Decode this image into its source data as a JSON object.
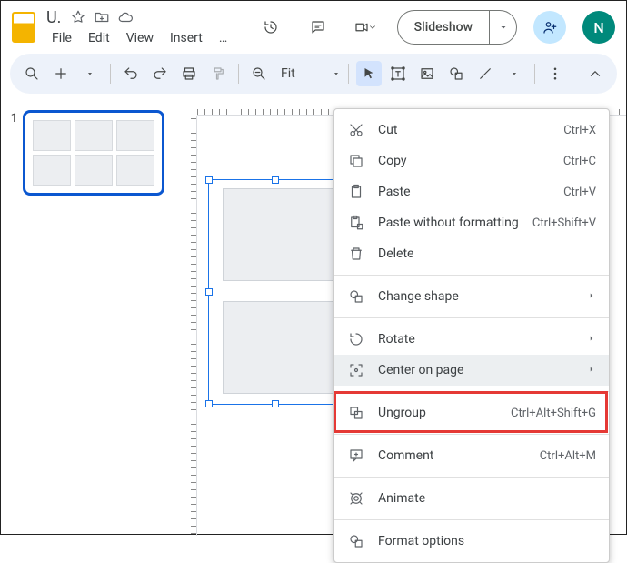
{
  "doc": {
    "title": "U."
  },
  "menubar": [
    "File",
    "Edit",
    "View",
    "Insert",
    "…"
  ],
  "toolbar": {
    "zoom_label": "Fit"
  },
  "slideshow": {
    "label": "Slideshow"
  },
  "avatar": {
    "letter": "N"
  },
  "thumbnails": [
    {
      "number": "1"
    }
  ],
  "context_menu": {
    "items": [
      {
        "icon": "cut-icon",
        "label": "Cut",
        "shortcut": "Ctrl+X"
      },
      {
        "icon": "copy-icon",
        "label": "Copy",
        "shortcut": "Ctrl+C"
      },
      {
        "icon": "paste-icon",
        "label": "Paste",
        "shortcut": "Ctrl+V"
      },
      {
        "icon": "paste-fmt-icon",
        "label": "Paste without formatting",
        "shortcut": "Ctrl+Shift+V"
      },
      {
        "icon": "delete-icon",
        "label": "Delete",
        "shortcut": ""
      },
      {
        "sep": true
      },
      {
        "icon": "shape-icon",
        "label": "Change shape",
        "shortcut": "",
        "submenu": true
      },
      {
        "sep": true
      },
      {
        "icon": "rotate-icon",
        "label": "Rotate",
        "shortcut": "",
        "submenu": true
      },
      {
        "icon": "center-icon",
        "label": "Center on page",
        "shortcut": "",
        "submenu": true,
        "hovered": true
      },
      {
        "sep": true
      },
      {
        "icon": "ungroup-icon",
        "label": "Ungroup",
        "shortcut": "Ctrl+Alt+Shift+G",
        "highlighted": true
      },
      {
        "sep": true
      },
      {
        "icon": "comment-icon",
        "label": "Comment",
        "shortcut": "Ctrl+Alt+M"
      },
      {
        "sep": true
      },
      {
        "icon": "animate-icon",
        "label": "Animate",
        "shortcut": ""
      },
      {
        "sep": true
      },
      {
        "icon": "format-icon",
        "label": "Format options",
        "shortcut": ""
      }
    ]
  }
}
